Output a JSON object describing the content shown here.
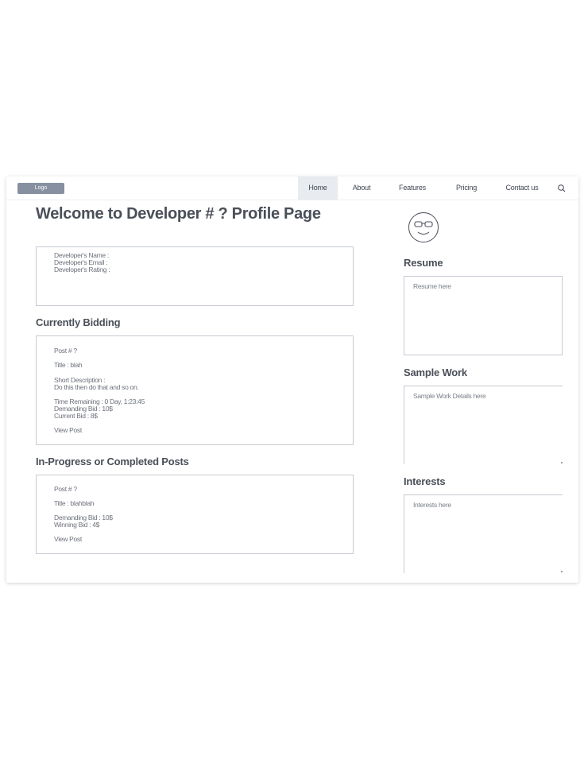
{
  "nav": {
    "logo": "Logo",
    "items": [
      "Home",
      "About",
      "Features",
      "Pricing",
      "Contact us"
    ],
    "active": "Home"
  },
  "page": {
    "title": "Welcome to Developer # ? Profile Page"
  },
  "developer_info": {
    "name_label": "Developer's Name :",
    "email_label": "Developer's Email :",
    "rating_label": "Developer's Rating :"
  },
  "currently_bidding": {
    "heading": "Currently Bidding",
    "post_number": "Post # ?",
    "title": "Title : blah",
    "short_description_label": "Short Description :",
    "short_description": "Do this then do that and so on.",
    "time_remaining": "Time Remaining : 0 Day, 1:23:45",
    "demanding_bid": "Demanding Bid : 10$",
    "current_bid": "Current Bid : 8$",
    "view_post": "View Post"
  },
  "in_progress": {
    "heading": "In-Progress or Completed Posts",
    "post_number": "Post # ?",
    "title": "Title : blahblah",
    "demanding_bid": "Demanding Bid : 10$",
    "winning_bid": "Winning Bid : 4$",
    "view_post": "View Post"
  },
  "sidebar": {
    "resume_heading": "Resume",
    "resume_placeholder": "Resume here",
    "sample_work_heading": "Sample Work",
    "sample_work_placeholder": "Sample Work Details here",
    "interests_heading": "Interests",
    "interests_placeholder": "Interests here"
  },
  "icons": {
    "search": "search-icon",
    "avatar": "face-with-glasses-icon"
  },
  "colors": {
    "logo_bg": "#8690a0",
    "active_nav_bg": "#e8ebf0",
    "border": "#c6cad1",
    "heading": "#4a4f58"
  }
}
